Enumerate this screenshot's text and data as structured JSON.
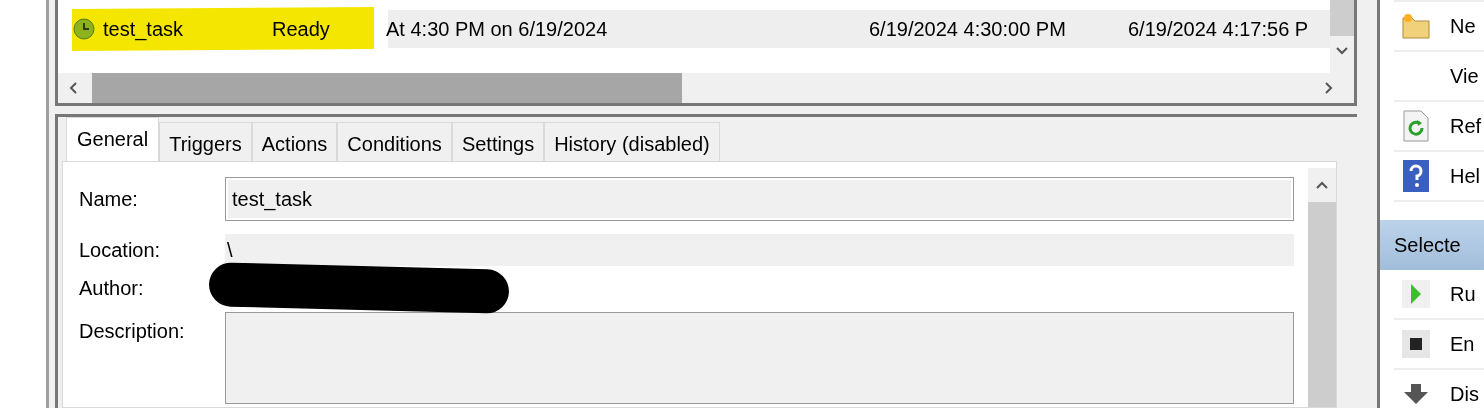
{
  "task_list": {
    "rows": [
      {
        "selected": true,
        "highlighted": true,
        "name": "test_task",
        "status": "Ready",
        "triggers": "At 4:30 PM on 6/19/2024",
        "next_run": "6/19/2024 4:30:00 PM",
        "last_run": "6/19/2024 4:17:56 P"
      }
    ]
  },
  "tabs": [
    {
      "label": "General",
      "selected": true
    },
    {
      "label": "Triggers",
      "selected": false
    },
    {
      "label": "Actions",
      "selected": false
    },
    {
      "label": "Conditions",
      "selected": false
    },
    {
      "label": "Settings",
      "selected": false
    },
    {
      "label": "History (disabled)",
      "selected": false
    }
  ],
  "general": {
    "name_label": "Name:",
    "name_value": "test_task",
    "location_label": "Location:",
    "location_value": "\\",
    "author_label": "Author:",
    "author_redacted": true,
    "description_label": "Description:"
  },
  "actions": [
    {
      "kind": "folder",
      "label": "Ne"
    },
    {
      "kind": "plain",
      "label": "Vie"
    },
    {
      "kind": "refresh",
      "label": "Ref"
    },
    {
      "kind": "help",
      "label": "Hel"
    },
    {
      "kind": "header",
      "label": "Selecte"
    },
    {
      "kind": "run",
      "label": "Ru"
    },
    {
      "kind": "stop",
      "label": "En"
    },
    {
      "kind": "down",
      "label": "Dis"
    }
  ]
}
